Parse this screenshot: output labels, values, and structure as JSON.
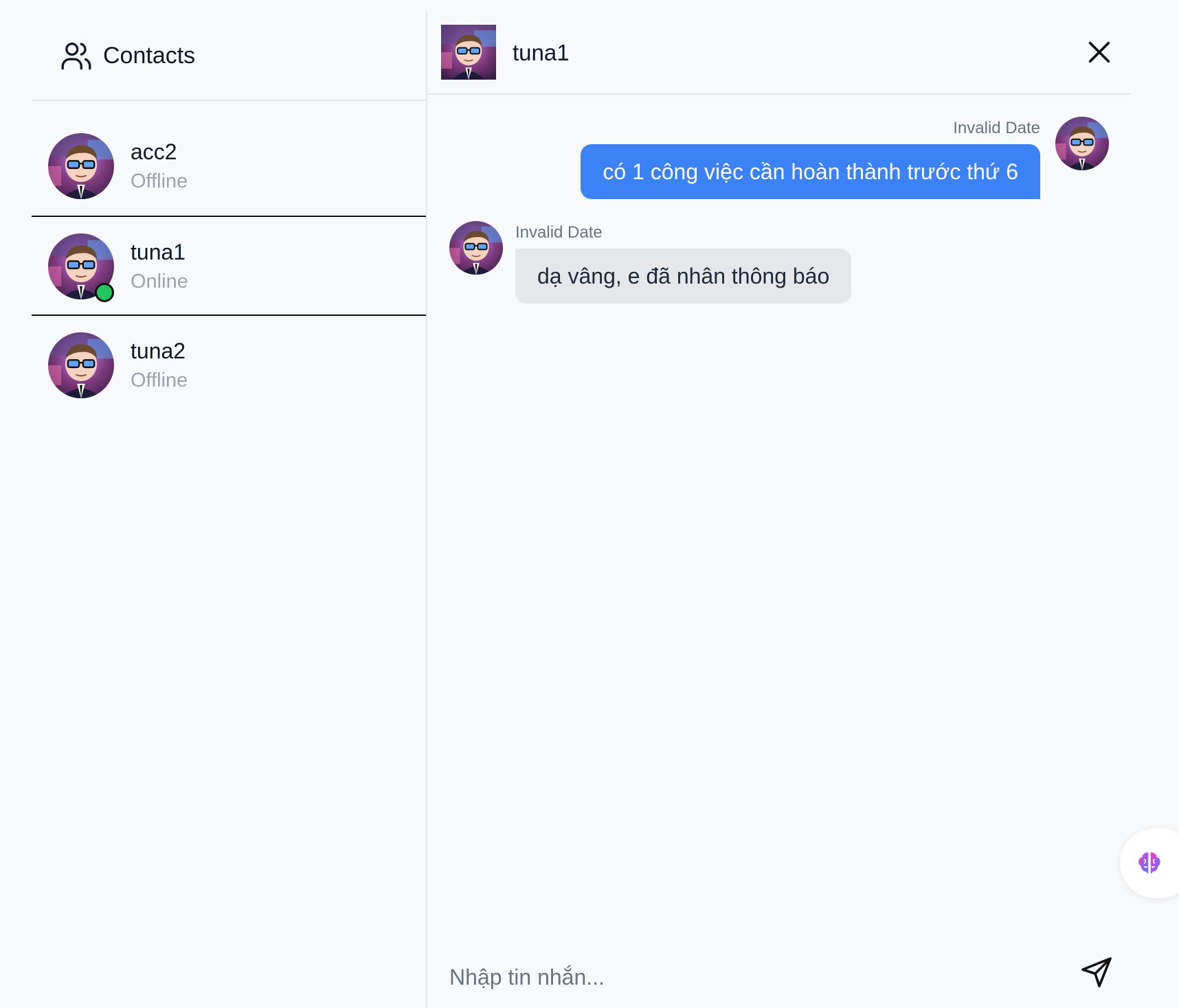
{
  "sidebar": {
    "title": "Contacts",
    "contacts": [
      {
        "name": "acc2",
        "status": "Offline",
        "online": false
      },
      {
        "name": "tuna1",
        "status": "Online",
        "online": true,
        "selected": true
      },
      {
        "name": "tuna2",
        "status": "Offline",
        "online": false
      }
    ]
  },
  "chat": {
    "name": "tuna1",
    "messages": [
      {
        "direction": "outgoing",
        "time": "Invalid Date",
        "text": "có 1 công việc cần hoàn thành trước thứ 6"
      },
      {
        "direction": "incoming",
        "time": "Invalid Date",
        "text": "dạ vâng, e đã nhân thông báo"
      }
    ]
  },
  "composer": {
    "placeholder": "Nhập tin nhắn..."
  },
  "icons": {
    "contacts": "users-icon",
    "close": "close-icon",
    "send": "send-icon",
    "floating": "brain-icon"
  },
  "colors": {
    "outgoing_bubble": "#3b82f6",
    "incoming_bubble": "#e5e7eb",
    "online_dot": "#22c55e",
    "background": "#f8f9fb"
  }
}
